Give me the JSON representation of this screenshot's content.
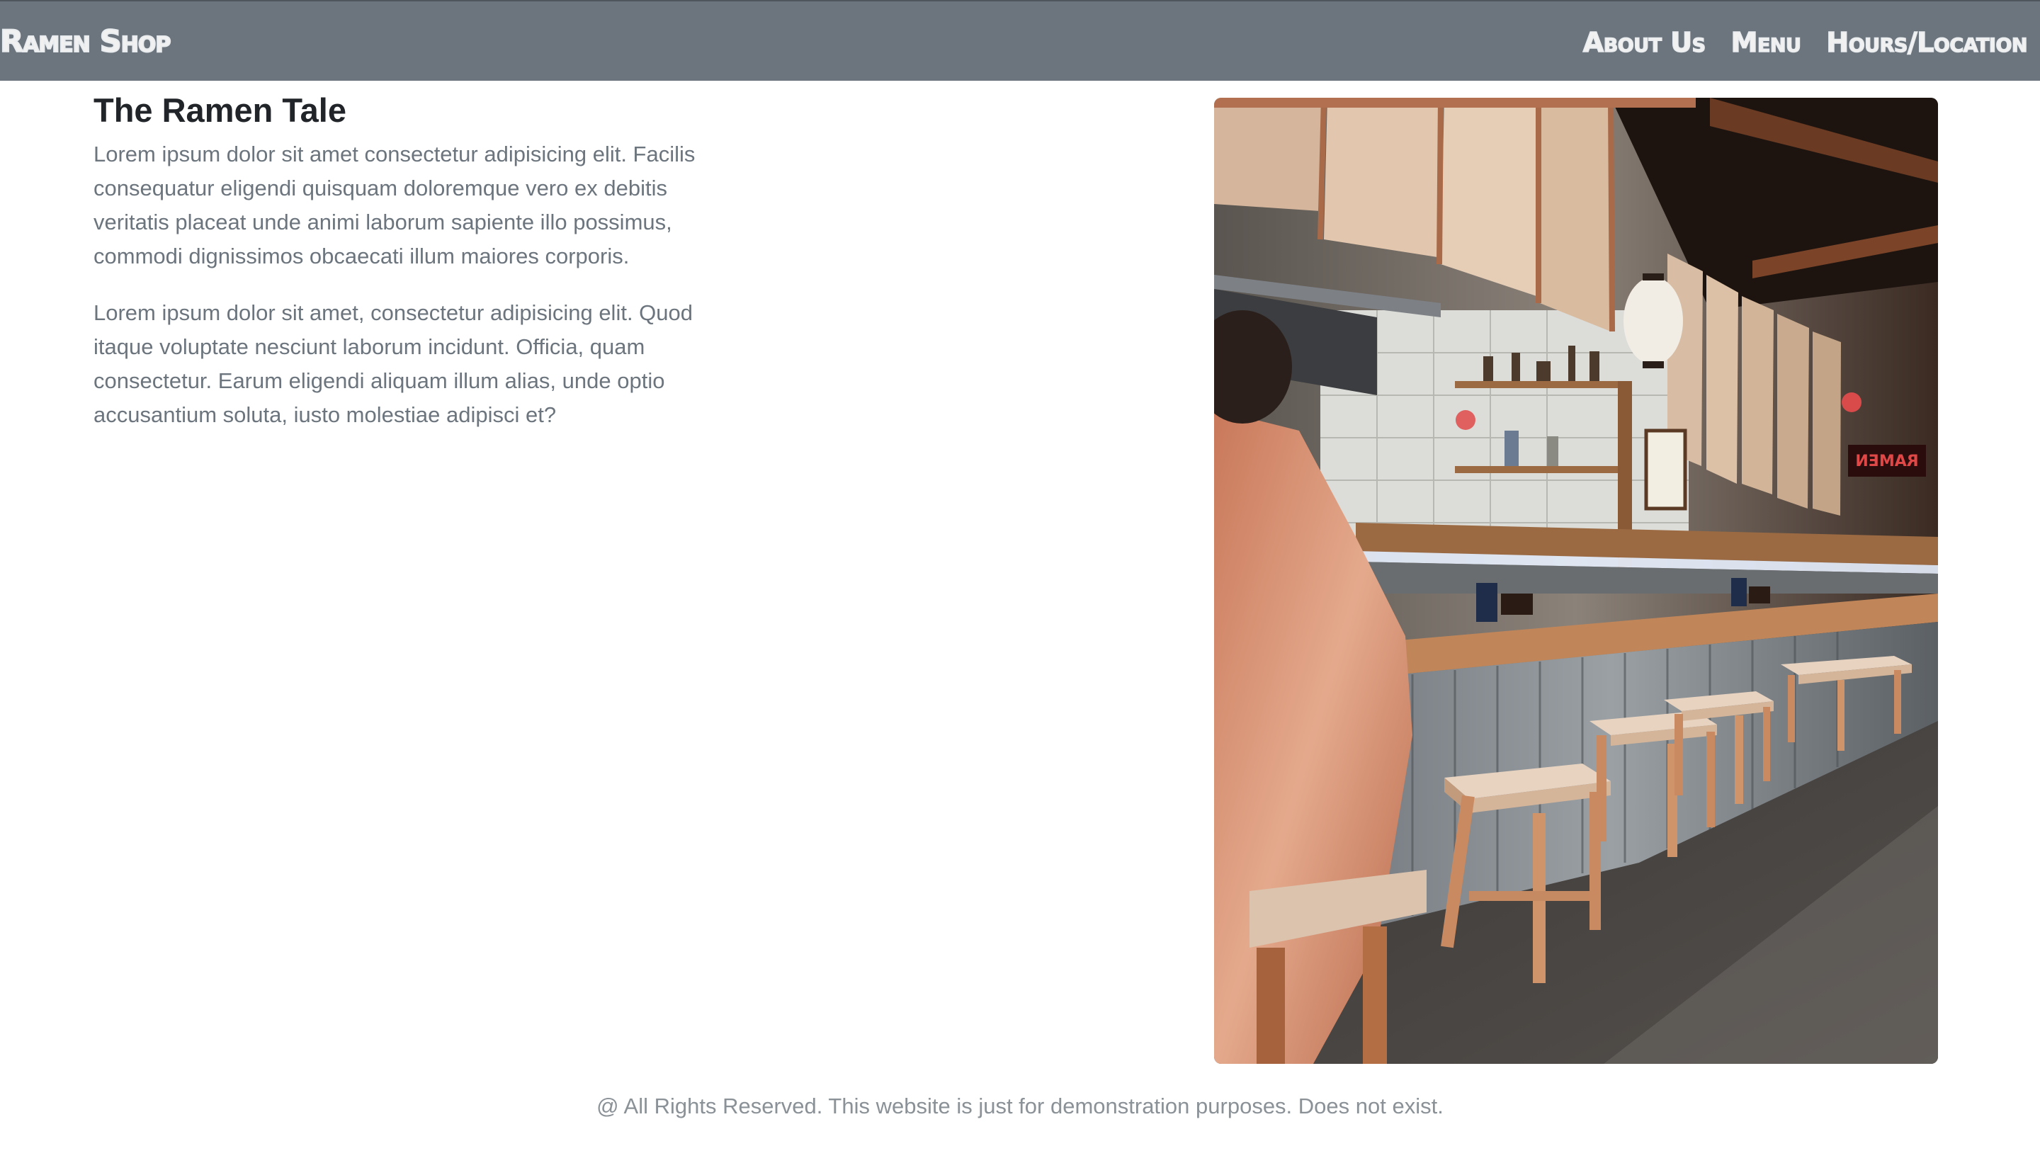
{
  "navbar": {
    "brand": "Ramen Shop",
    "links": [
      "About Us",
      "Menu",
      "Hours/Location"
    ]
  },
  "main": {
    "title": "The Ramen Tale",
    "paragraphs": [
      "Lorem ipsum dolor sit amet consectetur adipisicing elit. Facilis consequatur eligendi quisquam doloremque vero ex debitis veritatis placeat unde animi laborum sapiente illo possimus, commodi dignissimos obcaecati illum maiores corporis.",
      "Lorem ipsum dolor sit amet, consectetur adipisicing elit. Quod itaque voluptate nesciunt laborum incidunt. Officia, quam consectetur. Earum eligendi aliquam illum alias, unde optio accusantium soluta, iusto molestiae adipisci et?"
    ],
    "image_sign_text": "RAMEN"
  },
  "footer": {
    "text": "@ All Rights Reserved. This website is just for demonstration purposes. Does not exist."
  },
  "colors": {
    "navbar_bg": "#6c757d",
    "title": "#212529",
    "body_text": "#6c757d"
  }
}
